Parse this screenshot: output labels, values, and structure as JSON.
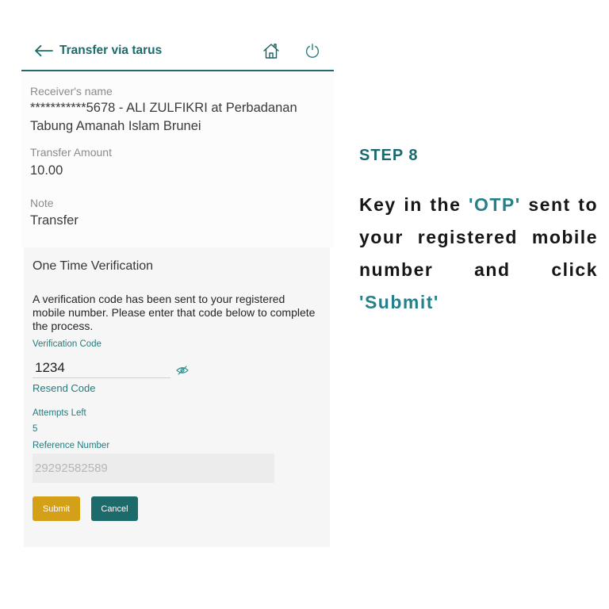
{
  "header": {
    "title": "Transfer via tarus",
    "icons": {
      "back": "arrow-left-icon",
      "home": "home-icon",
      "logout": "power-icon"
    }
  },
  "details": {
    "receiver_label": "Receiver's name",
    "receiver_value": "***********5678 - ALI ZULFIKRI at Perbadanan Tabung Amanah Islam Brunei",
    "amount_label": "Transfer Amount",
    "amount_value": "10.00",
    "note_label": "Note",
    "note_value": "Transfer"
  },
  "otp": {
    "title": "One Time Verification",
    "message": "A verification code has been sent to your registered mobile number. Please enter that code below to complete the process.",
    "code_label": "Verification Code",
    "code_value": "1234",
    "code_visibility_icon": "eye-slash-icon",
    "resend_label": "Resend Code",
    "attempts_label": "Attempts Left",
    "attempts_value": "5",
    "reference_label": "Reference Number",
    "reference_value": "29292582589",
    "submit_label": "Submit",
    "cancel_label": "Cancel"
  },
  "instruction": {
    "step": "STEP 8",
    "text_1": "Key in the ",
    "highlight_1": "'OTP'",
    "text_2": " sent to your registered mobile number and click ",
    "highlight_2": "'Submit'"
  },
  "colors": {
    "brand_teal": "#1d6b6c",
    "label_teal": "#237b7c",
    "step_teal": "#186a6e",
    "highlight_teal": "#25808a",
    "submit_gold": "#d4a017",
    "cancel_teal": "#1c6a6a"
  }
}
